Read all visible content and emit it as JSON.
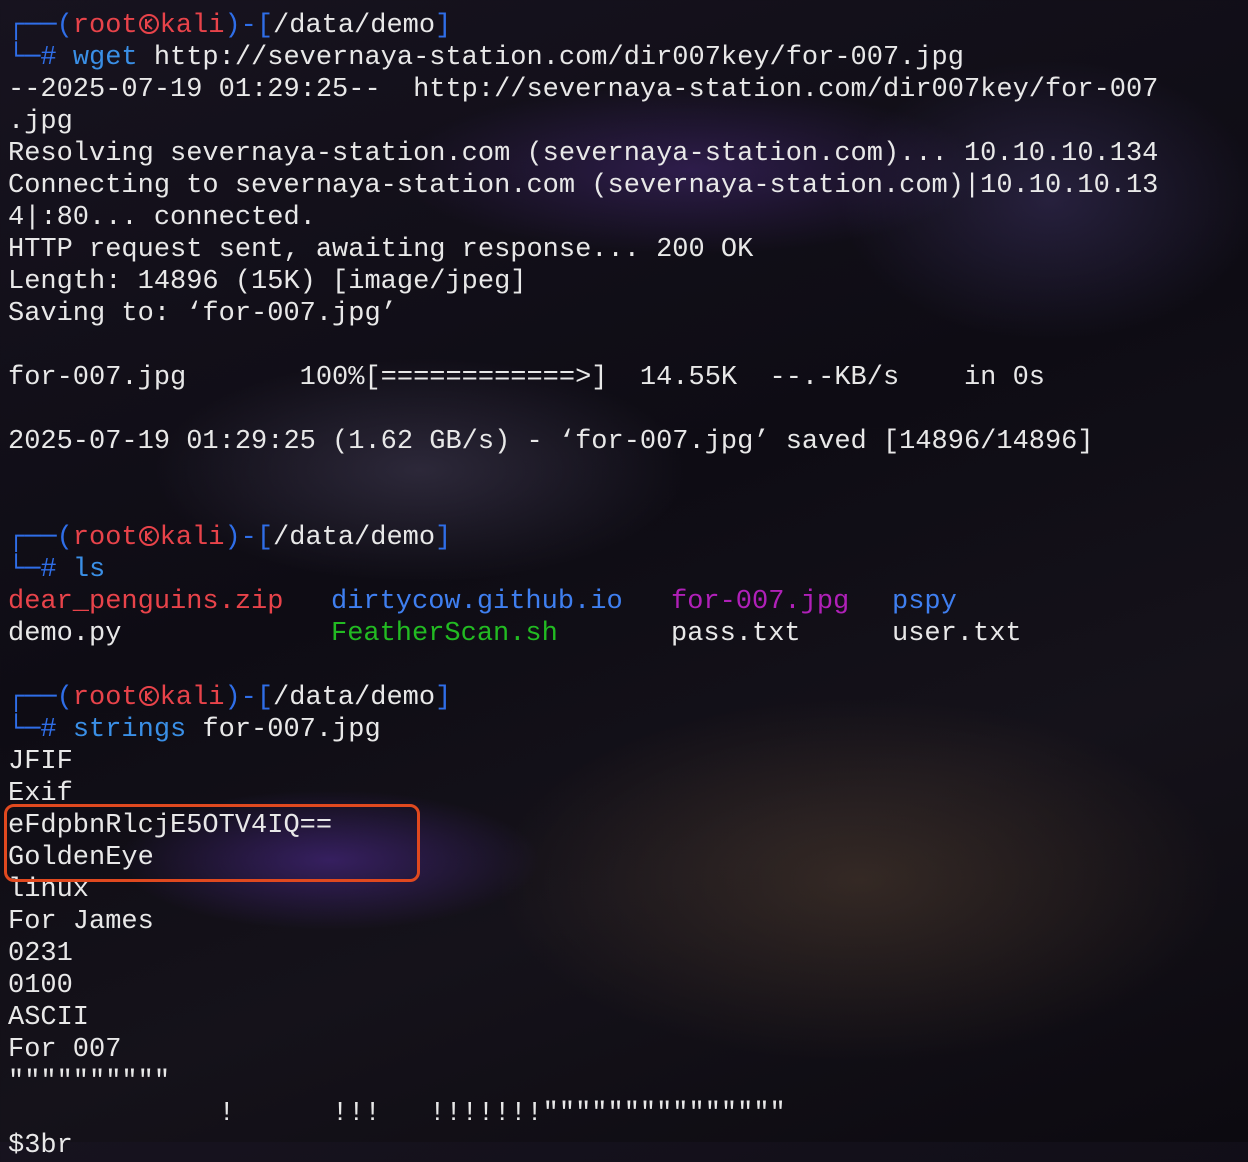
{
  "prompt": {
    "open_bracket": "┌──(",
    "user": "root",
    "host": "kali",
    "mid": ")-[",
    "path": "/data/demo",
    "close": "]",
    "second_prefix": "└─",
    "hash": "# "
  },
  "block1": {
    "command_name": "wget",
    "command_args": " http://severnaya-station.com/dir007key/for-007.jpg",
    "output": [
      "--2025-07-19 01:29:25--  http://severnaya-station.com/dir007key/for-007",
      ".jpg",
      "Resolving severnaya-station.com (severnaya-station.com)... 10.10.10.134",
      "Connecting to severnaya-station.com (severnaya-station.com)|10.10.10.13",
      "4|:80... connected.",
      "HTTP request sent, awaiting response... 200 OK",
      "Length: 14896 (15K) [image/jpeg]",
      "Saving to: ‘for-007.jpg’",
      "",
      "for-007.jpg       100%[============>]  14.55K  --.-KB/s    in 0s",
      "",
      "2025-07-19 01:29:25 (1.62 GB/s) - ‘for-007.jpg’ saved [14896/14896]"
    ]
  },
  "block2": {
    "command_name": "ls",
    "files_row1": [
      "dear_penguins.zip",
      "dirtycow.github.io",
      "for-007.jpg",
      "pspy"
    ],
    "files_row2": [
      "demo.py",
      "FeatherScan.sh",
      "pass.txt",
      "user.txt"
    ]
  },
  "block3": {
    "command_name": "strings",
    "command_args": " for-007.jpg",
    "output": [
      "JFIF",
      "Exif",
      "eFdpbnRlcjE5OTV4IQ==",
      "GoldenEye",
      "linux",
      "For James",
      "0231",
      "0100",
      "ASCII",
      "For 007",
      "\"\"\"\"\"\"\"\"\"\"",
      "             !      !!!   !!!!!!!\"\"\"\"\"\"\"\"\"\"\"\"\"\"\"",
      "$3br"
    ]
  },
  "colors": {
    "prompt_frame": "#2f6ee8",
    "prompt_user": "#e8434a",
    "command": "#3a8fe6",
    "highlight_box": "#e0491f",
    "zip_file": "#e8434a",
    "directory": "#3f7ff0",
    "image_file": "#b020b8",
    "executable": "#22bb22"
  },
  "icons": {
    "kali_skull": "kali-logo-icon"
  }
}
